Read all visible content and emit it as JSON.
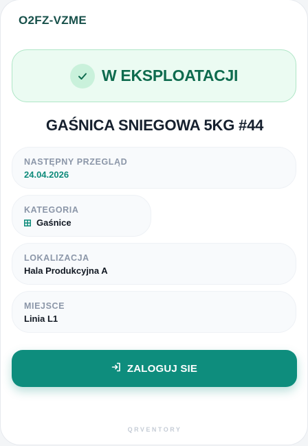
{
  "asset": {
    "code": "O2FZ-VZME",
    "status": "W EKSPLOATACJI",
    "name": "GAŚNICA SNIEGOWA 5KG #44"
  },
  "fields": {
    "inspection": {
      "label": "NASTĘPNY PRZEGLĄD",
      "value": "24.04.2026"
    },
    "category": {
      "label": "KATEGORIA",
      "value": "Gaśnice",
      "icon": "grid-icon"
    },
    "location": {
      "label": "LOKALIZACJA",
      "value": "Hala Produkcyjna A"
    },
    "place": {
      "label": "MIEJSCE",
      "value": "Linia L1"
    }
  },
  "actions": {
    "login_label": "ZALOGUJ SIE",
    "login_icon": "login-icon"
  },
  "footer": {
    "brand": "QRVENTORY"
  },
  "colors": {
    "accent": "#0e8d7d",
    "status_bg": "#ebfbf2",
    "status_text": "#0e6b4e"
  }
}
